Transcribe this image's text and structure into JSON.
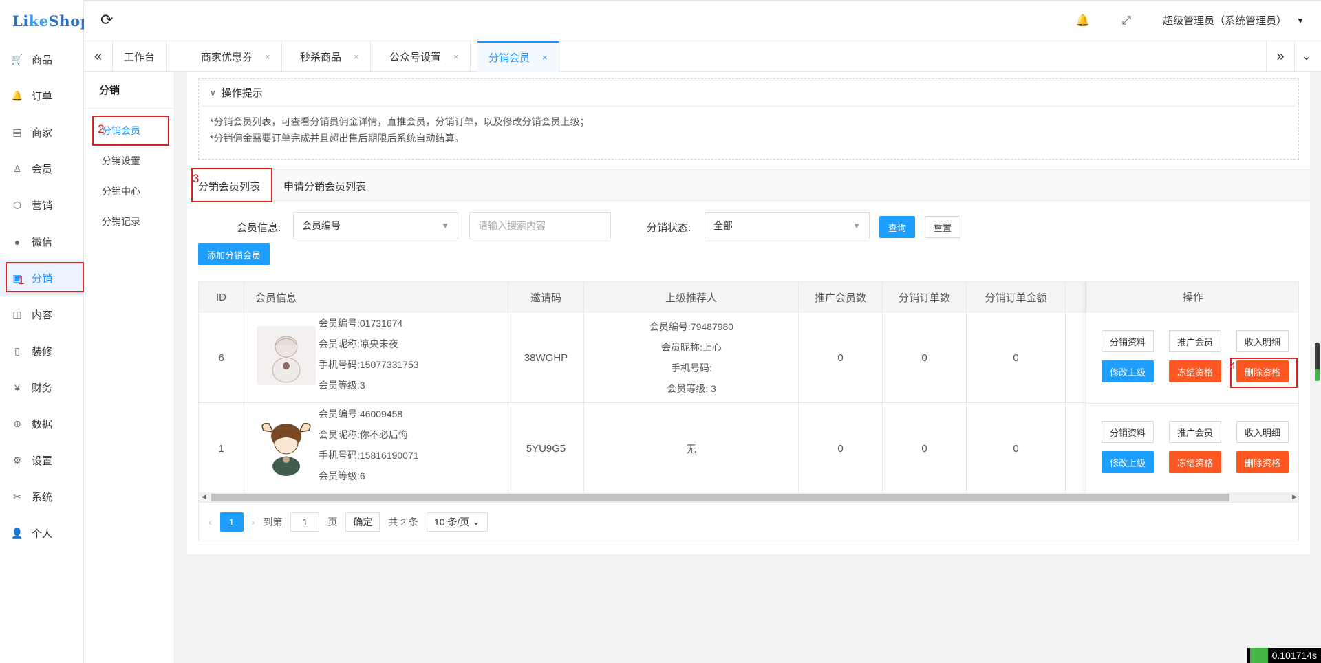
{
  "app": {
    "logo_text_1": "Li",
    "logo_text_2": "ke",
    "logo_text_3": "Shop"
  },
  "colors": {
    "primary": "#1e9fff",
    "danger": "#ff5722",
    "annotation": "#e02020"
  },
  "topbar": {
    "user": "超级管理员（系统管理员）"
  },
  "leftnav": [
    {
      "icon": "cart-icon",
      "glyph": "🛒",
      "label": "商品"
    },
    {
      "icon": "bell-icon",
      "glyph": "🔔",
      "label": "订单"
    },
    {
      "icon": "shop-icon",
      "glyph": "▤",
      "label": "商家"
    },
    {
      "icon": "user-icon",
      "glyph": "♙",
      "label": "会员"
    },
    {
      "icon": "box-icon",
      "glyph": "⬡",
      "label": "营销"
    },
    {
      "icon": "wechat-icon",
      "glyph": "●",
      "label": "微信"
    },
    {
      "icon": "distribution-icon",
      "glyph": "▣",
      "label": "分销"
    },
    {
      "icon": "book-icon",
      "glyph": "◫",
      "label": "内容"
    },
    {
      "icon": "mobile-icon",
      "glyph": "▯",
      "label": "装修"
    },
    {
      "icon": "yen-icon",
      "glyph": "¥",
      "label": "财务"
    },
    {
      "icon": "globe-icon",
      "glyph": "⊕",
      "label": "数据"
    },
    {
      "icon": "gear-icon",
      "glyph": "⚙",
      "label": "设置"
    },
    {
      "icon": "tools-icon",
      "glyph": "✂",
      "label": "系统"
    },
    {
      "icon": "person-icon",
      "glyph": "👤",
      "label": "个人"
    }
  ],
  "tabs": [
    {
      "label": "工作台",
      "closable": false
    },
    {
      "label": "商家优惠券",
      "closable": true
    },
    {
      "label": "秒杀商品",
      "closable": true
    },
    {
      "label": "公众号设置",
      "closable": true
    },
    {
      "label": "分销会员",
      "closable": true
    }
  ],
  "subnav": {
    "title": "分销",
    "items": [
      "分销会员",
      "分销设置",
      "分销中心",
      "分销记录"
    ]
  },
  "tips": {
    "title": "操作提示",
    "lines": [
      "*分销会员列表，可查看分销员佣金详情，直推会员，分销订单，以及修改分销会员上级；",
      "*分销佣金需要订单完成并且超出售后期限后系统自动结算。"
    ]
  },
  "list_tabs": [
    "分销会员列表",
    "申请分销会员列表"
  ],
  "search": {
    "member_label": "会员信息:",
    "member_select": "会员编号",
    "keyword_placeholder": "请输入搜索内容",
    "status_label": "分销状态:",
    "status_select": "全部",
    "query": "查询",
    "reset": "重置",
    "add": "添加分销会员"
  },
  "table": {
    "headers": [
      "ID",
      "会员信息",
      "邀请码",
      "上级推荐人",
      "推广会员数",
      "分销订单数",
      "分销订单金额",
      "操作"
    ],
    "rows": [
      {
        "id": "6",
        "info": [
          "会员编号:01731674",
          "会员昵称:凉央未夜",
          "手机号码:15077331753",
          "会员等级:3"
        ],
        "code": "38WGHP",
        "ref": [
          "会员编号:79487980",
          "会员昵称:上心",
          "手机号码:",
          "会员等级: 3"
        ],
        "promo": "0",
        "orders": "0",
        "amount": "0"
      },
      {
        "id": "1",
        "info": [
          "会员编号:46009458",
          "会员昵称:你不必后悔",
          "手机号码:15816190071",
          "会员等级:6"
        ],
        "code": "5YU9G5",
        "ref": [
          "无"
        ],
        "promo": "0",
        "orders": "0",
        "amount": "0"
      }
    ],
    "ops": {
      "detail": "分销资料",
      "promote": "推广会员",
      "income": "收入明细",
      "edit_parent": "修改上级",
      "freeze": "冻结资格",
      "delete": "删除资格"
    }
  },
  "pager": {
    "current": "1",
    "goto": "到第",
    "page_input": "1",
    "page": "页",
    "confirm": "确定",
    "total": "共 2 条",
    "per_page": "10 条/页"
  },
  "annotations": [
    "1",
    "2",
    "3",
    "4"
  ],
  "timer": "0.101714s"
}
